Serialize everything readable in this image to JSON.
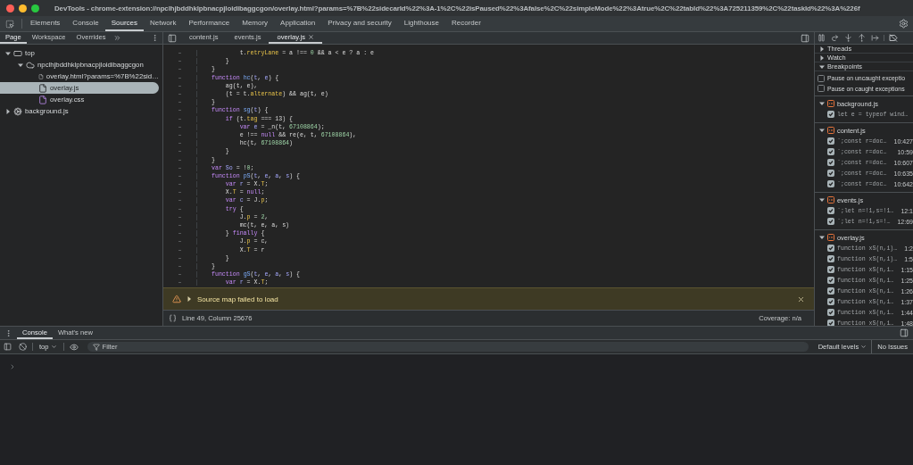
{
  "window": {
    "title": "DevTools - chrome-extension://npclhjbddhklpbnacpjloidibaggcgon/overlay.html?params=%7B%22sidecarId%22%3A-1%2C%22isPaused%22%3Afalse%2C%22simpleMode%22%3Atrue%2C%22tabId%22%3A725211359%2C%22taskId%22%3A%226f"
  },
  "main_tabs": [
    {
      "label": "Elements",
      "selected": false
    },
    {
      "label": "Console",
      "selected": false
    },
    {
      "label": "Sources",
      "selected": true
    },
    {
      "label": "Network",
      "selected": false
    },
    {
      "label": "Performance",
      "selected": false
    },
    {
      "label": "Memory",
      "selected": false
    },
    {
      "label": "Application",
      "selected": false
    },
    {
      "label": "Privacy and security",
      "selected": false
    },
    {
      "label": "Lighthouse",
      "selected": false
    },
    {
      "label": "Recorder",
      "selected": false
    }
  ],
  "navigator": {
    "tabs": [
      {
        "label": "Page",
        "selected": true
      },
      {
        "label": "Workspace",
        "selected": false
      },
      {
        "label": "Overrides",
        "selected": false
      }
    ],
    "tree": [
      {
        "label": "top",
        "kind": "frame",
        "expanded": true,
        "selected": false,
        "children": [
          {
            "label": "npclhjbddhklpbnacpjloidibaggcgon",
            "kind": "origin",
            "expanded": true,
            "selected": false,
            "children": [
              {
                "label": "overlay.html?params=%7B%22sid…",
                "kind": "document",
                "selected": false
              },
              {
                "label": "overlay.js",
                "kind": "script",
                "selected": true
              },
              {
                "label": "overlay.css",
                "kind": "stylesheet",
                "selected": false
              }
            ]
          }
        ]
      },
      {
        "label": "background.js",
        "kind": "worker",
        "expanded": false,
        "selected": false
      }
    ]
  },
  "editor": {
    "tabs": [
      {
        "label": "content.js",
        "selected": false,
        "closable": false
      },
      {
        "label": "events.js",
        "selected": false,
        "closable": false
      },
      {
        "label": "overlay.js",
        "selected": true,
        "closable": true
      }
    ],
    "code_lines": [
      {
        "number": "–",
        "tokens": [
          {
            "text": "        t.",
            "kind": "plain"
          },
          {
            "text": "retryLane",
            "kind": "property"
          },
          {
            "text": " = a !== ",
            "kind": "plain"
          },
          {
            "text": "0",
            "kind": "number"
          },
          {
            "text": " && a < e ? a : e",
            "kind": "plain"
          }
        ]
      },
      {
        "number": "–",
        "tokens": [
          {
            "text": "    }",
            "kind": "plain"
          }
        ]
      },
      {
        "number": "–",
        "tokens": [
          {
            "text": "}",
            "kind": "plain"
          }
        ]
      },
      {
        "number": "–",
        "tokens": [
          {
            "text": "function ",
            "kind": "keyword"
          },
          {
            "text": "hc",
            "kind": "function"
          },
          {
            "text": "(",
            "kind": "plain"
          },
          {
            "text": "t",
            "kind": "variable"
          },
          {
            "text": ", ",
            "kind": "plain"
          },
          {
            "text": "e",
            "kind": "variable"
          },
          {
            "text": ") {",
            "kind": "plain"
          }
        ]
      },
      {
        "number": "–",
        "tokens": [
          {
            "text": "    ag(t, e),",
            "kind": "plain"
          }
        ]
      },
      {
        "number": "–",
        "tokens": [
          {
            "text": "    (t = t.",
            "kind": "plain"
          },
          {
            "text": "alternate",
            "kind": "property"
          },
          {
            "text": ") && ag(t, e)",
            "kind": "plain"
          }
        ]
      },
      {
        "number": "–",
        "tokens": [
          {
            "text": "}",
            "kind": "plain"
          }
        ]
      },
      {
        "number": "–",
        "tokens": [
          {
            "text": "function ",
            "kind": "keyword"
          },
          {
            "text": "sg",
            "kind": "function"
          },
          {
            "text": "(",
            "kind": "plain"
          },
          {
            "text": "t",
            "kind": "variable"
          },
          {
            "text": ") {",
            "kind": "plain"
          }
        ]
      },
      {
        "number": "–",
        "tokens": [
          {
            "text": "    if",
            "kind": "keyword"
          },
          {
            "text": " (t.",
            "kind": "plain"
          },
          {
            "text": "tag",
            "kind": "property"
          },
          {
            "text": " === 13) {",
            "kind": "plain"
          }
        ]
      },
      {
        "number": "–",
        "tokens": [
          {
            "text": "        var ",
            "kind": "keyword"
          },
          {
            "text": "e",
            "kind": "variable"
          },
          {
            "text": " = _n(t, ",
            "kind": "plain"
          },
          {
            "text": "67108864",
            "kind": "number"
          },
          {
            "text": ");",
            "kind": "plain"
          }
        ]
      },
      {
        "number": "–",
        "tokens": [
          {
            "text": "        e !== ",
            "kind": "plain"
          },
          {
            "text": "null",
            "kind": "keyword"
          },
          {
            "text": " && re(e, t, ",
            "kind": "plain"
          },
          {
            "text": "67108864",
            "kind": "number"
          },
          {
            "text": "),",
            "kind": "plain"
          }
        ]
      },
      {
        "number": "–",
        "tokens": [
          {
            "text": "        hc(t, ",
            "kind": "plain"
          },
          {
            "text": "67108864",
            "kind": "number"
          },
          {
            "text": ")",
            "kind": "plain"
          }
        ]
      },
      {
        "number": "–",
        "tokens": [
          {
            "text": "    }",
            "kind": "plain"
          }
        ]
      },
      {
        "number": "–",
        "tokens": [
          {
            "text": "}",
            "kind": "plain"
          }
        ]
      },
      {
        "number": "–",
        "tokens": [
          {
            "text": "var ",
            "kind": "keyword"
          },
          {
            "text": "So",
            "kind": "variable"
          },
          {
            "text": " = !",
            "kind": "plain"
          },
          {
            "text": "0",
            "kind": "number"
          },
          {
            "text": ";",
            "kind": "plain"
          }
        ]
      },
      {
        "number": "–",
        "tokens": [
          {
            "text": "function ",
            "kind": "keyword"
          },
          {
            "text": "pS",
            "kind": "function"
          },
          {
            "text": "(",
            "kind": "plain"
          },
          {
            "text": "t",
            "kind": "variable"
          },
          {
            "text": ", ",
            "kind": "plain"
          },
          {
            "text": "e",
            "kind": "variable"
          },
          {
            "text": ", ",
            "kind": "plain"
          },
          {
            "text": "a",
            "kind": "variable"
          },
          {
            "text": ", ",
            "kind": "plain"
          },
          {
            "text": "s",
            "kind": "variable"
          },
          {
            "text": ") {",
            "kind": "plain"
          }
        ]
      },
      {
        "number": "–",
        "tokens": [
          {
            "text": "    var ",
            "kind": "keyword"
          },
          {
            "text": "r",
            "kind": "variable"
          },
          {
            "text": " = X.",
            "kind": "plain"
          },
          {
            "text": "T",
            "kind": "property"
          },
          {
            "text": ";",
            "kind": "plain"
          }
        ]
      },
      {
        "number": "–",
        "tokens": [
          {
            "text": "    X.",
            "kind": "plain"
          },
          {
            "text": "T",
            "kind": "property"
          },
          {
            "text": " = ",
            "kind": "plain"
          },
          {
            "text": "null",
            "kind": "keyword"
          },
          {
            "text": ";",
            "kind": "plain"
          }
        ]
      },
      {
        "number": "–",
        "tokens": [
          {
            "text": "    var ",
            "kind": "keyword"
          },
          {
            "text": "c",
            "kind": "variable"
          },
          {
            "text": " = J.",
            "kind": "plain"
          },
          {
            "text": "p",
            "kind": "property"
          },
          {
            "text": ";",
            "kind": "plain"
          }
        ]
      },
      {
        "number": "–",
        "tokens": [
          {
            "text": "    try",
            "kind": "keyword"
          },
          {
            "text": " {",
            "kind": "plain"
          }
        ]
      },
      {
        "number": "–",
        "tokens": [
          {
            "text": "        J.",
            "kind": "plain"
          },
          {
            "text": "p",
            "kind": "property"
          },
          {
            "text": " = ",
            "kind": "plain"
          },
          {
            "text": "2",
            "kind": "number"
          },
          {
            "text": ",",
            "kind": "plain"
          }
        ]
      },
      {
        "number": "–",
        "tokens": [
          {
            "text": "        mc(t, e, a, s)",
            "kind": "plain"
          }
        ]
      },
      {
        "number": "–",
        "tokens": [
          {
            "text": "    } ",
            "kind": "plain"
          },
          {
            "text": "finally",
            "kind": "keyword"
          },
          {
            "text": " {",
            "kind": "plain"
          }
        ]
      },
      {
        "number": "–",
        "tokens": [
          {
            "text": "        J.",
            "kind": "plain"
          },
          {
            "text": "p",
            "kind": "property"
          },
          {
            "text": " = c,",
            "kind": "plain"
          }
        ]
      },
      {
        "number": "–",
        "tokens": [
          {
            "text": "        X.",
            "kind": "plain"
          },
          {
            "text": "T",
            "kind": "property"
          },
          {
            "text": " = r",
            "kind": "plain"
          }
        ]
      },
      {
        "number": "–",
        "tokens": [
          {
            "text": "    }",
            "kind": "plain"
          }
        ]
      },
      {
        "number": "–",
        "tokens": [
          {
            "text": "}",
            "kind": "plain"
          }
        ]
      },
      {
        "number": "–",
        "tokens": [
          {
            "text": "function ",
            "kind": "keyword"
          },
          {
            "text": "gS",
            "kind": "function"
          },
          {
            "text": "(",
            "kind": "plain"
          },
          {
            "text": "t",
            "kind": "variable"
          },
          {
            "text": ", ",
            "kind": "plain"
          },
          {
            "text": "e",
            "kind": "variable"
          },
          {
            "text": ", ",
            "kind": "plain"
          },
          {
            "text": "a",
            "kind": "variable"
          },
          {
            "text": ", ",
            "kind": "plain"
          },
          {
            "text": "s",
            "kind": "variable"
          },
          {
            "text": ") {",
            "kind": "plain"
          }
        ]
      },
      {
        "number": "–",
        "tokens": [
          {
            "text": "    var ",
            "kind": "keyword"
          },
          {
            "text": "r",
            "kind": "variable"
          },
          {
            "text": " = X.",
            "kind": "plain"
          },
          {
            "text": "T",
            "kind": "property"
          },
          {
            "text": ";",
            "kind": "plain"
          }
        ]
      }
    ],
    "warning": {
      "message": "Source map failed to load",
      "expanded": false
    },
    "status": {
      "position": "Line 49, Column 25676",
      "coverage": "Coverage: n/a"
    }
  },
  "debugger": {
    "sections": [
      {
        "label": "Threads",
        "expanded": false
      },
      {
        "label": "Watch",
        "expanded": false
      },
      {
        "label": "Breakpoints",
        "expanded": true
      }
    ],
    "exception_options": [
      {
        "label": "Pause on uncaught exceptio",
        "checked": false
      },
      {
        "label": "Pause on caught exceptions",
        "checked": false
      }
    ],
    "breakpoint_files": [
      {
        "file": "background.js",
        "expanded": true,
        "breakpoints": [
          {
            "code": "let e = typeof wind…",
            "checked": true
          }
        ]
      },
      {
        "file": "content.js",
        "expanded": true,
        "breakpoints": [
          {
            "code": "`;const r=doc…",
            "location": "10:427",
            "checked": true
          },
          {
            "code": "`;const r=doc…",
            "location": "10:59",
            "checked": true
          },
          {
            "code": "`;const r=doc…",
            "location": "10:607",
            "checked": true
          },
          {
            "code": "`;const r=doc…",
            "location": "10:635",
            "checked": true
          },
          {
            "code": "`;const r=doc…",
            "location": "10:642",
            "checked": true
          }
        ]
      },
      {
        "file": "events.js",
        "expanded": true,
        "breakpoints": [
          {
            "code": "`;let n=!1,s=!1…",
            "location": "12:1",
            "checked": true
          },
          {
            "code": "`;let n=!1,s=!…",
            "location": "12:69",
            "checked": true
          }
        ]
      },
      {
        "file": "overlay.js",
        "expanded": true,
        "breakpoints": [
          {
            "code": "function xS(n,i)…",
            "location": "1:2",
            "checked": true
          },
          {
            "code": "function xS(n,i)…",
            "location": "1:5",
            "checked": true
          },
          {
            "code": "function xS(n,i…",
            "location": "1:15",
            "checked": true
          },
          {
            "code": "function xS(n,i…",
            "location": "1:25",
            "checked": true
          },
          {
            "code": "function xS(n,i…",
            "location": "1:26",
            "checked": true
          },
          {
            "code": "function xS(n,i…",
            "location": "1:37",
            "checked": true
          },
          {
            "code": "function xS(n,i…",
            "location": "1:44",
            "checked": true
          },
          {
            "code": "function xS(n,i…",
            "location": "1:48",
            "checked": true
          }
        ]
      }
    ]
  },
  "drawer": {
    "tabs": [
      {
        "label": "Console",
        "selected": true
      },
      {
        "label": "What's new",
        "selected": false
      }
    ],
    "context": "top",
    "filter": {
      "placeholder": "Filter"
    },
    "levels": "Default levels",
    "issues": "No Issues"
  }
}
